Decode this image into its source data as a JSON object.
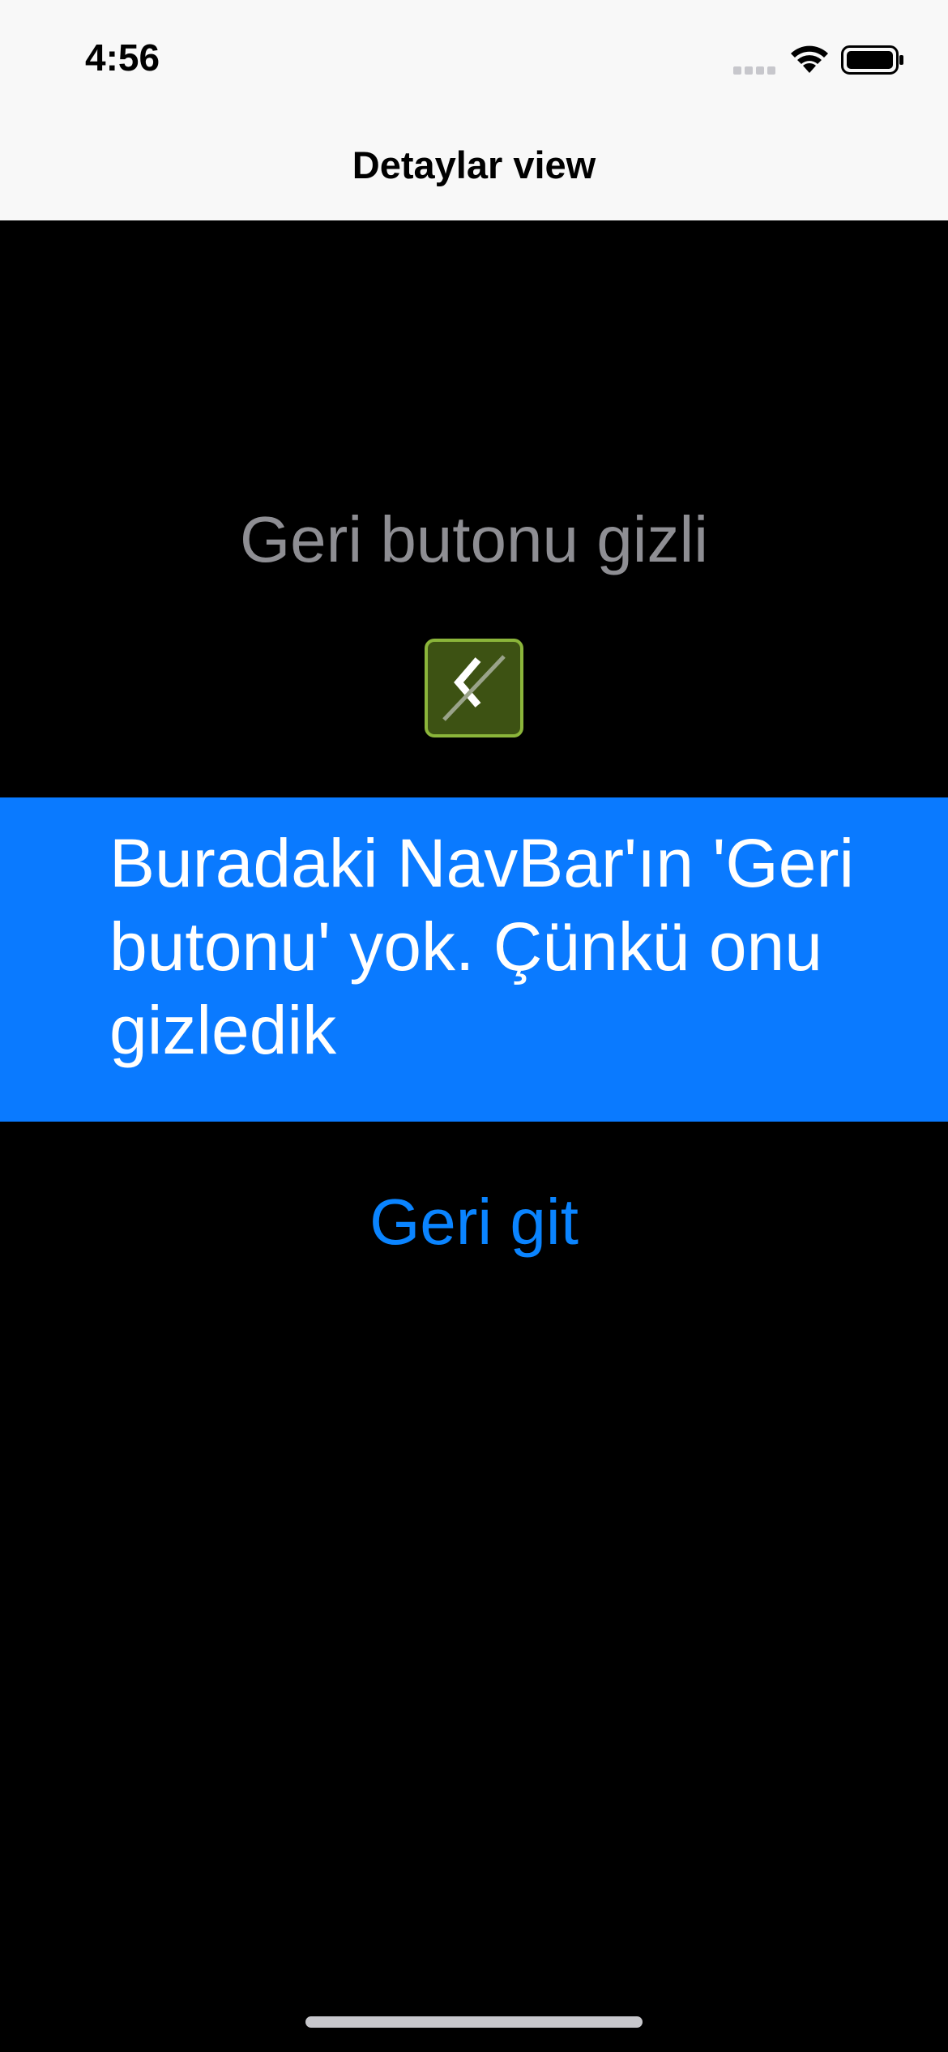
{
  "status_bar": {
    "time": "4:56",
    "signal_icon": "cellular-signal-icon",
    "wifi_icon": "wifi-icon",
    "battery_icon": "battery-icon"
  },
  "nav_bar": {
    "title": "Detaylar view"
  },
  "content": {
    "hidden_label": "Geri butonu gizli",
    "placeholder_icon": "hidden-back-button-icon",
    "info_text": "Buradaki NavBar'ın 'Geri butonu' yok. Çünkü onu gizledik",
    "back_link": "Geri git"
  },
  "colors": {
    "background": "#000000",
    "nav_background": "#f8f8f8",
    "banner": "#0a7aff",
    "link": "#0a84ff",
    "secondary_text": "#8e8e93"
  }
}
